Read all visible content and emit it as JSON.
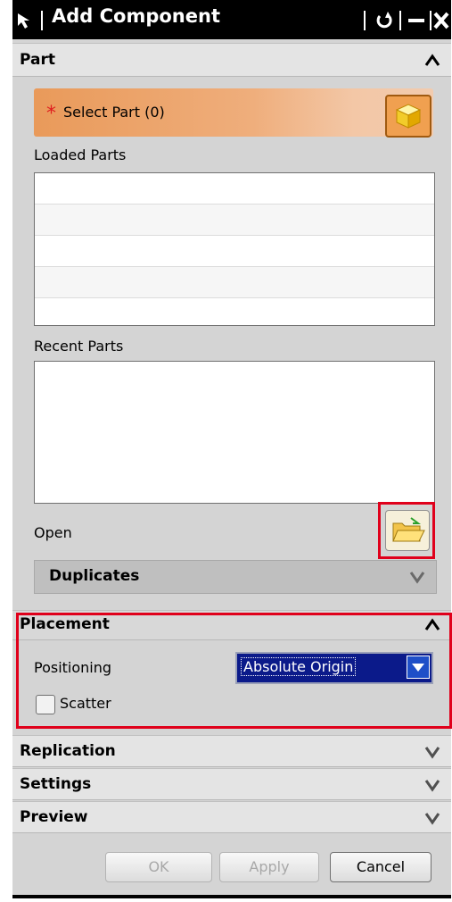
{
  "title_bar": {
    "title": "Add Component",
    "icons": [
      "cursor-arrow-icon",
      "reset-icon",
      "minimize-icon",
      "close-icon"
    ]
  },
  "part": {
    "section_label": "Part",
    "select_part_label": "Select Part (0)",
    "loaded_parts_label": "Loaded Parts",
    "loaded_parts_rows": [
      "",
      "",
      "",
      "",
      ""
    ],
    "recent_parts_label": "Recent Parts",
    "open_label": "Open",
    "duplicates_label": "Duplicates"
  },
  "placement": {
    "section_label": "Placement",
    "positioning_label": "Positioning",
    "positioning_value": "Absolute Origin",
    "scatter_label": "Scatter",
    "scatter_checked": false
  },
  "replication": {
    "section_label": "Replication"
  },
  "settings": {
    "section_label": "Settings"
  },
  "preview": {
    "section_label": "Preview"
  },
  "buttons": {
    "ok": "OK",
    "apply": "Apply",
    "cancel": "Cancel"
  },
  "colors": {
    "highlight_box": "#e0001b",
    "select_bar": "#e99a5a",
    "combo_selected": "#0b1a8a"
  }
}
